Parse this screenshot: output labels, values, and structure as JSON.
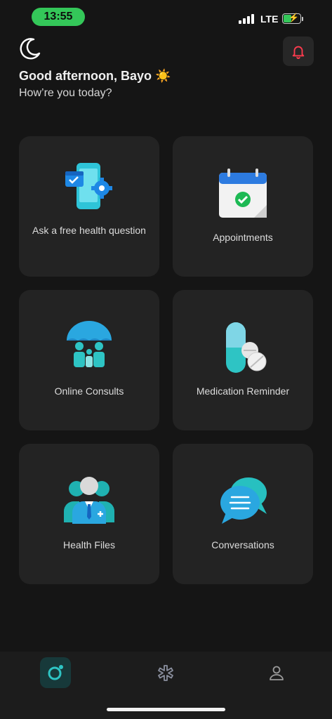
{
  "status_bar": {
    "time": "13:55",
    "network": "LTE",
    "battery_level": 0.4
  },
  "header": {
    "theme_icon": "moon-icon",
    "notification_icon": "bell-icon",
    "greeting": "Good afternoon, Bayo ☀️",
    "subgreeting": "How’re you today?"
  },
  "cards": [
    {
      "label": "Ask a free health question",
      "icon": "phone-settings-icon"
    },
    {
      "label": "Appointments",
      "icon": "calendar-check-icon"
    },
    {
      "label": "Online Consults",
      "icon": "family-umbrella-icon"
    },
    {
      "label": "Medication Reminder",
      "icon": "pills-icon"
    },
    {
      "label": "Health Files",
      "icon": "doctor-profile-icon"
    },
    {
      "label": "Conversations",
      "icon": "chat-bubbles-icon"
    }
  ],
  "bottom_nav": {
    "items": [
      {
        "name": "home",
        "icon": "home-ring-icon",
        "active": true
      },
      {
        "name": "services",
        "icon": "medical-star-icon",
        "active": false
      },
      {
        "name": "profile",
        "icon": "user-icon",
        "active": false
      }
    ]
  },
  "colors": {
    "background": "#151515",
    "card": "#232323",
    "accent_teal": "#2ec4c4",
    "bell_red": "#ff3b4e",
    "status_green": "#34c759"
  }
}
